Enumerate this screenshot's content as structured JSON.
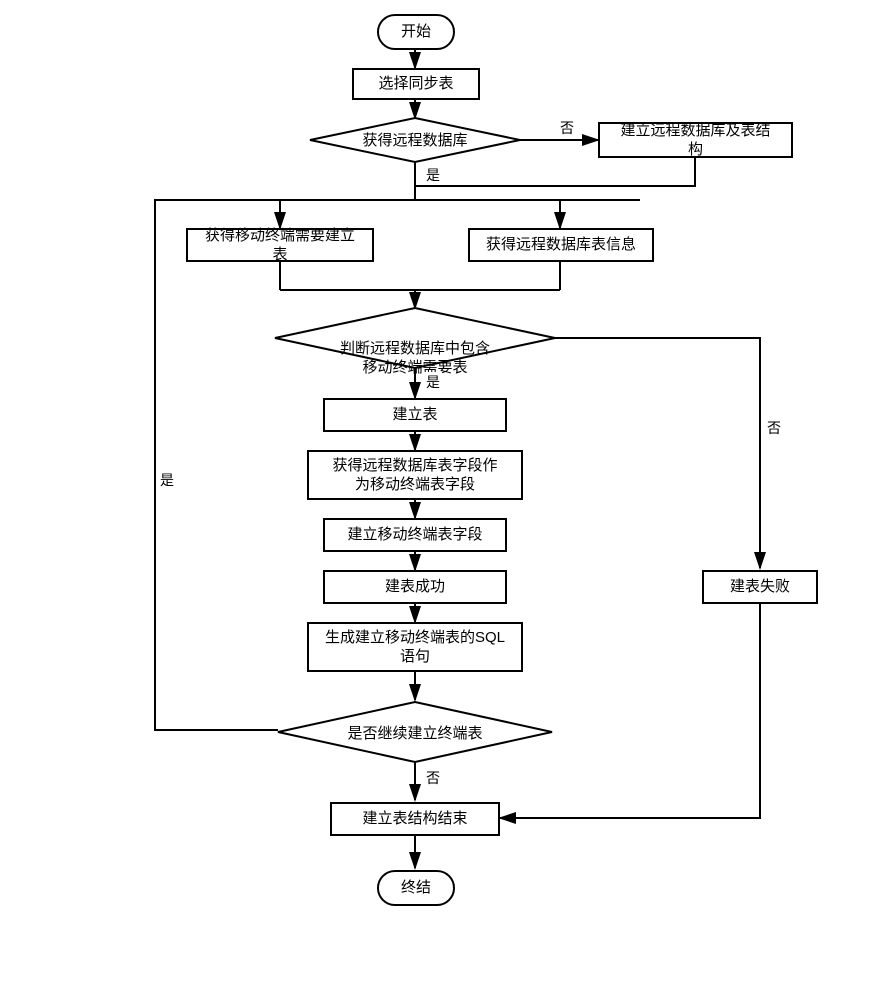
{
  "nodes": {
    "start": "开始",
    "selectSync": "选择同步表",
    "getRemoteDb": "获得远程数据库",
    "createRemoteDb": "建立远程数据库及表结构",
    "getNeedTables": "获得移动终端需要建立表",
    "getRemoteTableInfo": "获得远程数据库表信息",
    "judgeContains": "判断远程数据库中包含\n移动终端需要表",
    "createTable": "建立表",
    "getFields": "获得远程数据库表字段作\n为移动终端表字段",
    "createTerminalFields": "建立移动终端表字段",
    "createSuccess": "建表成功",
    "genSql": "生成建立移动终端表的SQL\n语句",
    "continueCreate": "是否继续建立终端表",
    "createFail": "建表失败",
    "structDone": "建立表结构结束",
    "end": "终结"
  },
  "edges": {
    "yes": "是",
    "no": "否"
  }
}
